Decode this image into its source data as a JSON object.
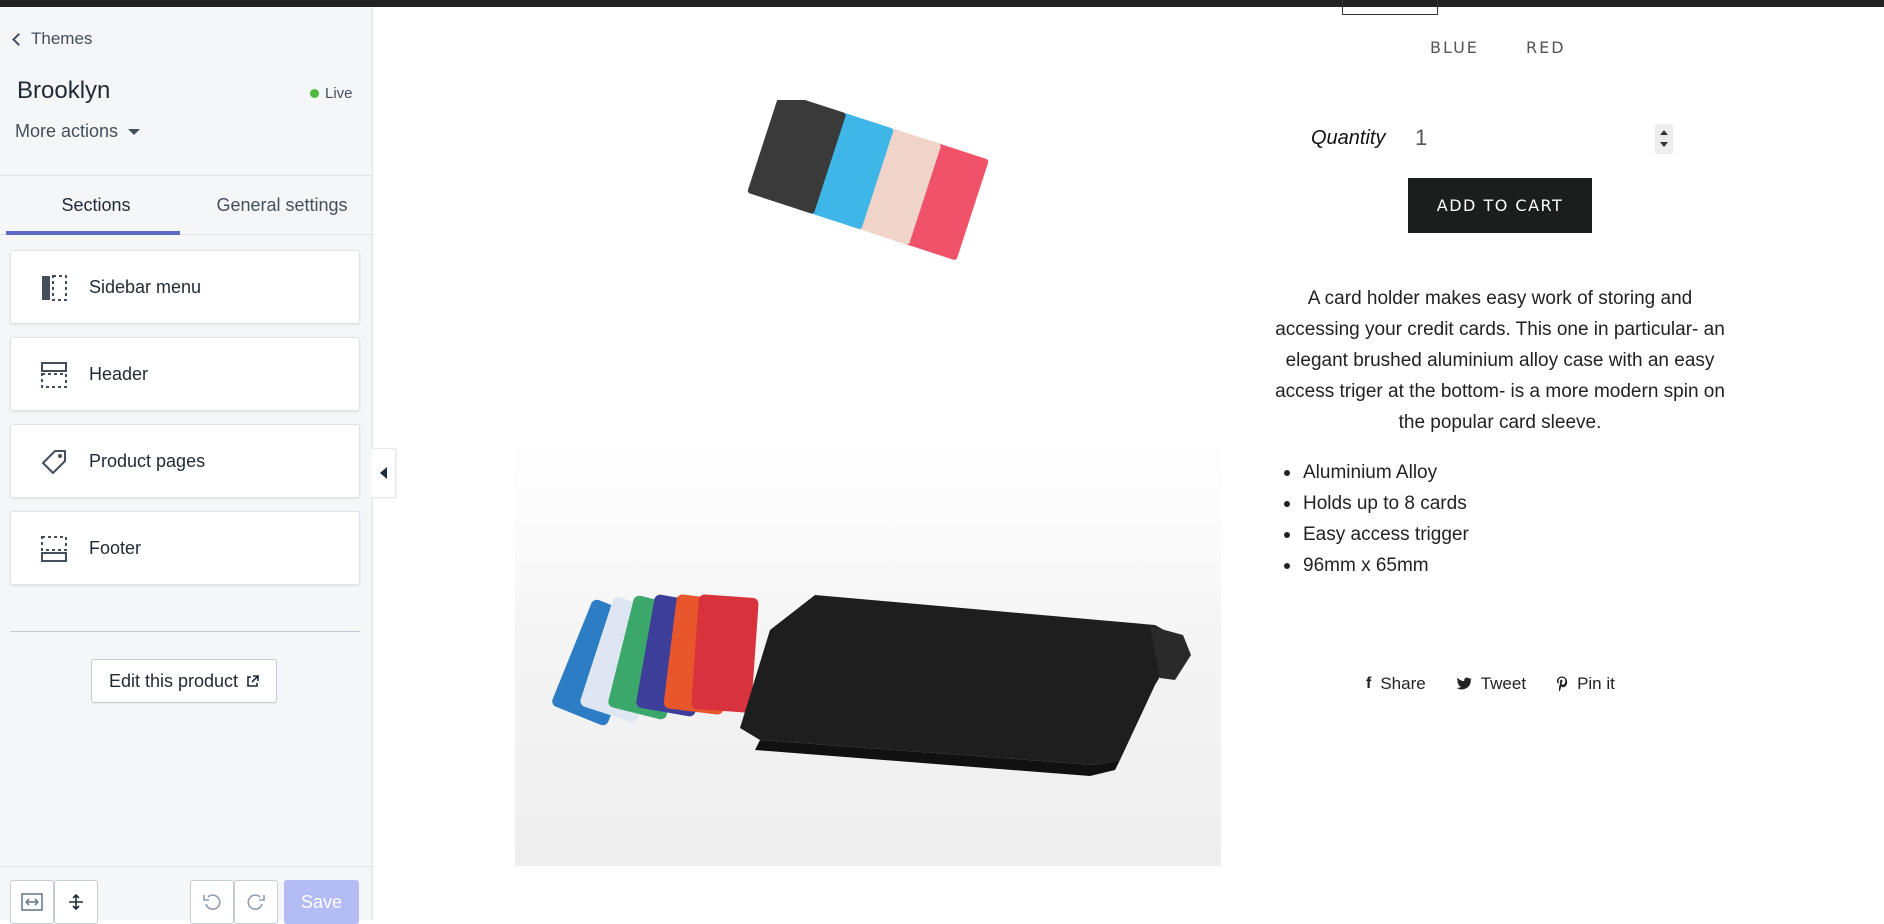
{
  "sidebar": {
    "back_label": "Themes",
    "theme_name": "Brooklyn",
    "status": "Live",
    "status_color": "#50b83c",
    "more_actions": "More actions",
    "tabs": [
      {
        "label": "Sections",
        "active": true
      },
      {
        "label": "General settings",
        "active": false
      }
    ],
    "sections": [
      {
        "label": "Sidebar menu",
        "icon": "sidebar-menu-icon"
      },
      {
        "label": "Header",
        "icon": "header-icon"
      },
      {
        "label": "Product pages",
        "icon": "tag-icon"
      },
      {
        "label": "Footer",
        "icon": "footer-icon"
      }
    ],
    "edit_product": "Edit this product",
    "save_label": "Save"
  },
  "product": {
    "variants": [
      "BLUE",
      "RED"
    ],
    "quantity_label": "Quantity",
    "quantity_value": "1",
    "add_to_cart": "ADD TO CART",
    "description": "A card holder makes easy work of storing and accessing your credit cards. This  one in particular- an elegant brushed aluminium alloy case with an easy access triger at the bottom- is a more modern spin on the popular card sleeve.",
    "features": [
      "Aluminium Alloy",
      "Holds up to 8 cards",
      "Easy access trigger",
      "96mm x 65mm"
    ],
    "share": {
      "share": "Share",
      "tweet": "Tweet",
      "pin": "Pin it"
    }
  }
}
